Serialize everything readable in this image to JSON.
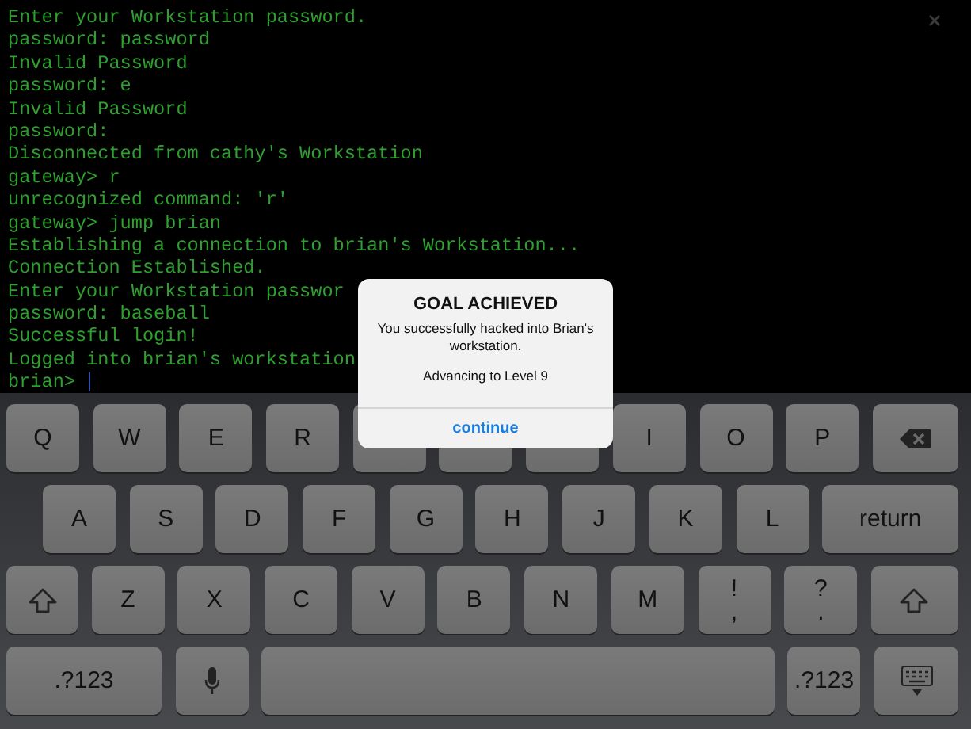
{
  "terminal": {
    "lines": [
      "Enter your Workstation password.",
      "password: password",
      "Invalid Password",
      "password: e",
      "Invalid Password",
      "password:",
      "Disconnected from cathy's Workstation",
      "gateway> r",
      "unrecognized command: 'r'",
      "gateway> jump brian",
      "Establishing a connection to brian's Workstation...",
      "Connection Established.",
      "Enter your Workstation passwor",
      "password: baseball",
      "Successful login!",
      "Logged into brian's workstation",
      "brian>"
    ]
  },
  "dialog": {
    "title": "GOAL ACHIEVED",
    "message": "You successfully hacked into Brian's workstation.",
    "note": "Advancing to Level 9",
    "button": "continue"
  },
  "keyboard": {
    "rows": [
      {
        "keys": [
          {
            "kind": "letter",
            "label": "Q"
          },
          {
            "kind": "letter",
            "label": "W"
          },
          {
            "kind": "letter",
            "label": "E"
          },
          {
            "kind": "letter",
            "label": "R"
          },
          {
            "kind": "covered"
          },
          {
            "kind": "covered"
          },
          {
            "kind": "covered"
          },
          {
            "kind": "letter",
            "label": "I"
          },
          {
            "kind": "letter",
            "label": "O"
          },
          {
            "kind": "letter",
            "label": "P"
          },
          {
            "kind": "backspace"
          }
        ]
      },
      {
        "keys": [
          {
            "kind": "letter",
            "label": "A"
          },
          {
            "kind": "letter",
            "label": "S"
          },
          {
            "kind": "letter",
            "label": "D"
          },
          {
            "kind": "letter",
            "label": "F"
          },
          {
            "kind": "letter",
            "label": "G"
          },
          {
            "kind": "letter",
            "label": "H"
          },
          {
            "kind": "letter",
            "label": "J"
          },
          {
            "kind": "letter",
            "label": "K"
          },
          {
            "kind": "letter",
            "label": "L"
          },
          {
            "kind": "letter",
            "label": "return"
          }
        ]
      },
      {
        "keys": [
          {
            "kind": "shift"
          },
          {
            "kind": "letter",
            "label": "Z"
          },
          {
            "kind": "letter",
            "label": "X"
          },
          {
            "kind": "letter",
            "label": "C"
          },
          {
            "kind": "letter",
            "label": "V"
          },
          {
            "kind": "letter",
            "label": "B"
          },
          {
            "kind": "letter",
            "label": "N"
          },
          {
            "kind": "letter",
            "label": "M"
          },
          {
            "kind": "punct",
            "label": "!",
            "sublabel": ","
          },
          {
            "kind": "punct",
            "label": "?",
            "sublabel": "."
          },
          {
            "kind": "shift"
          }
        ]
      },
      {
        "keys": [
          {
            "kind": "letter",
            "label": ".?123"
          },
          {
            "kind": "mic"
          },
          {
            "kind": "space"
          },
          {
            "kind": "letter",
            "label": ".?123"
          },
          {
            "kind": "hide"
          }
        ]
      }
    ]
  }
}
